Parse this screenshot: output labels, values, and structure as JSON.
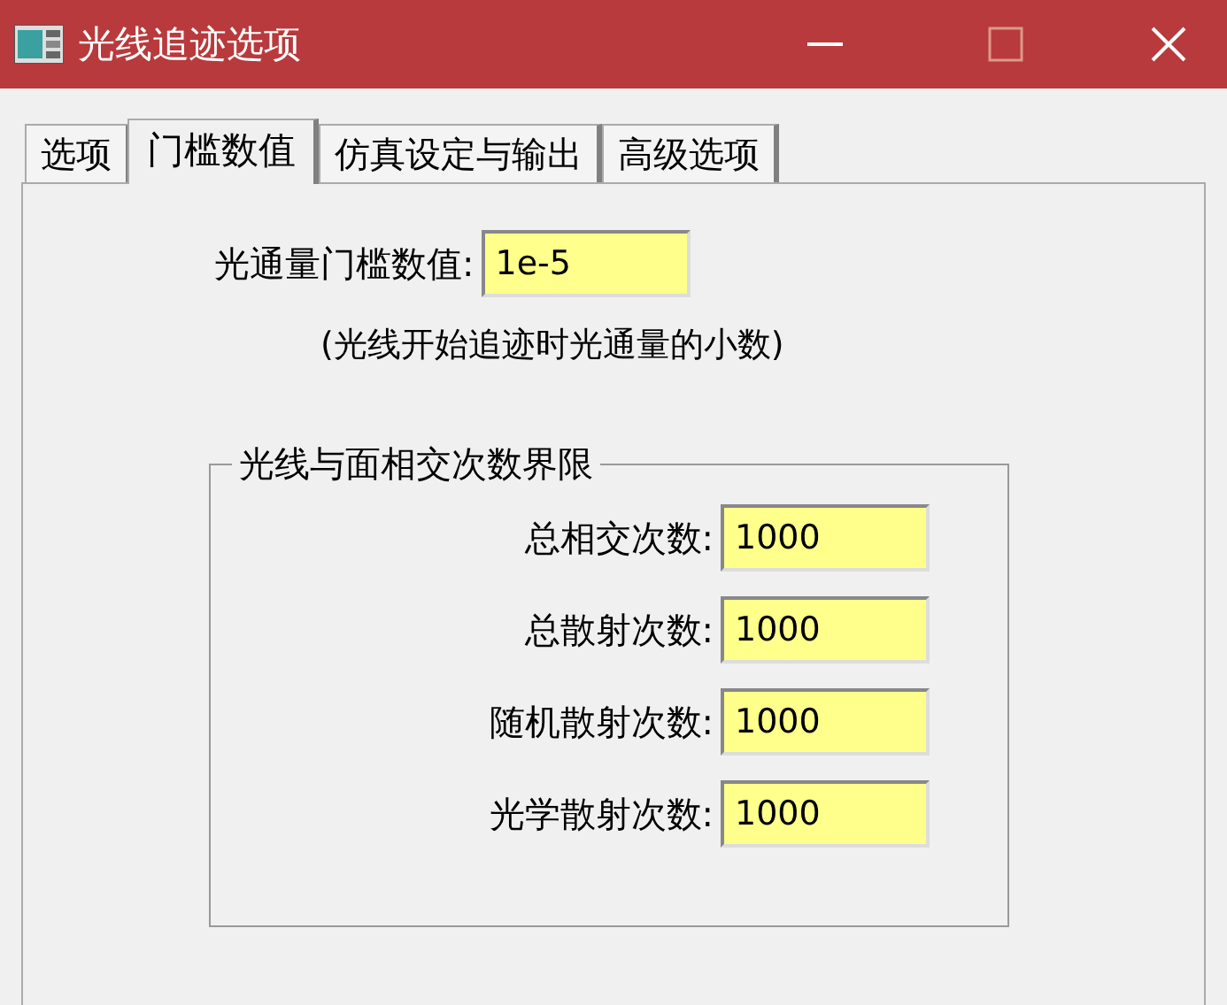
{
  "window": {
    "title": "光线追迹选项"
  },
  "tabs": [
    {
      "label": "选项",
      "selected": false
    },
    {
      "label": "门槛数值",
      "selected": true
    },
    {
      "label": "仿真设定与输出",
      "selected": false
    },
    {
      "label": "高级选项",
      "selected": false
    }
  ],
  "threshold": {
    "label": "光通量门槛数值:",
    "value": "1e-5",
    "note": "(光线开始追迹时光通量的小数)"
  },
  "group": {
    "title": "光线与面相交次数界限",
    "fields": [
      {
        "label": "总相交次数:",
        "value": "1000"
      },
      {
        "label": "总散射次数:",
        "value": "1000"
      },
      {
        "label": "随机散射次数:",
        "value": "1000"
      },
      {
        "label": "光学散射次数:",
        "value": "1000"
      }
    ]
  }
}
